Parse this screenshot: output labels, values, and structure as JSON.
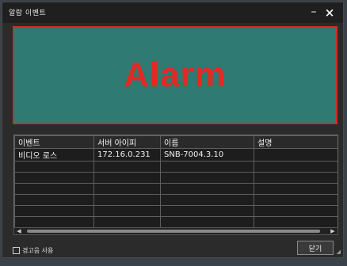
{
  "window": {
    "title": "알람 이벤트",
    "minimize_glyph": "–",
    "close_glyph": "×"
  },
  "alarm": {
    "text": "Alarm",
    "text_color": "#e12a24",
    "banner_color": "#2f7a72",
    "border_color": "#d22a26"
  },
  "table": {
    "headers": [
      "이벤트",
      "서버 아이피",
      "이름",
      "설명"
    ],
    "rows": [
      [
        "비디오 로스",
        "172.16.0.231",
        "SNB-7004.3.10",
        ""
      ],
      [
        "",
        "",
        "",
        ""
      ],
      [
        "",
        "",
        "",
        ""
      ],
      [
        "",
        "",
        "",
        ""
      ],
      [
        "",
        "",
        "",
        ""
      ],
      [
        "",
        "",
        "",
        ""
      ],
      [
        "",
        "",
        "",
        ""
      ]
    ]
  },
  "scrollbar": {
    "left_arrow": "◀",
    "right_arrow": "▶"
  },
  "footer": {
    "alarm_sound_label": "경고음 사용",
    "close_button_label": "닫기",
    "resize_grip": "◢"
  }
}
